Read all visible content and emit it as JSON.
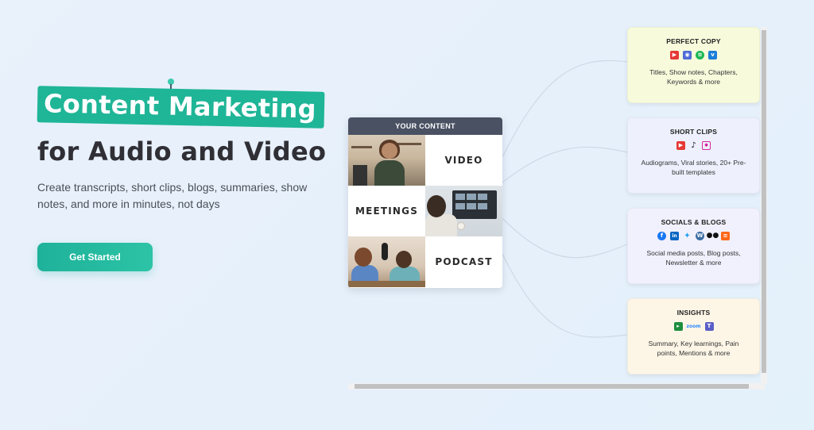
{
  "hero": {
    "title_highlight": "Content Marketing",
    "title_rest": "for Audio and Video",
    "subtitle": "Create transcripts, short clips, blogs, summaries, show notes, and more in minutes, not days",
    "cta_label": "Get Started"
  },
  "content_card": {
    "header": "YOUR CONTENT",
    "labels": {
      "video": "VIDEO",
      "meetings": "MEETINGS",
      "podcast": "PODCAST"
    }
  },
  "outputs": [
    {
      "title": "PERFECT COPY",
      "desc": "Titles, Show notes, Chapters, Keywords & more",
      "bg": "#f7fbdc",
      "icons": [
        "youtube-icon",
        "apple-podcasts-icon",
        "spotify-icon",
        "vimeo-icon"
      ]
    },
    {
      "title": "SHORT CLIPS",
      "desc": "Audiograms, Viral stories, 20+ Pre-built templates",
      "bg": "#eef1fd",
      "icons": [
        "youtube-icon",
        "tiktok-icon",
        "instagram-icon"
      ]
    },
    {
      "title": "SOCIALS & BLOGS",
      "desc": "Social media posts, Blog posts, Newsletter & more",
      "bg": "#f1f0fd",
      "icons": [
        "facebook-icon",
        "linkedin-icon",
        "twitter-icon",
        "wordpress-icon",
        "medium-icon",
        "substack-icon"
      ]
    },
    {
      "title": "INSIGHTS",
      "desc": "Summary, Key learnings, Pain points, Mentions & more",
      "bg": "#fdf6e7",
      "icons": [
        "google-meet-icon",
        "zoom-icon",
        "teams-icon"
      ],
      "zoom_text": "zoom"
    }
  ],
  "colors": {
    "accent": "#1fb597",
    "header_dark": "#4a5163",
    "title_dark": "#2f2f35"
  }
}
